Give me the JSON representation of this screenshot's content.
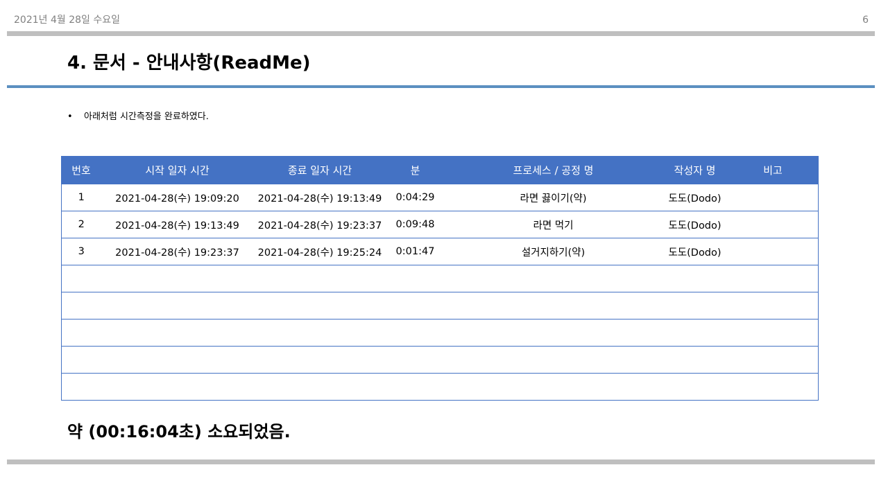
{
  "header": {
    "date": "2021년 4월 28일 수요일",
    "page_number": "6"
  },
  "title": "4. 문서 - 안내사항(ReadMe)",
  "bullet": {
    "text": "아래처럼 시간측정을 완료하였다."
  },
  "table": {
    "headers": [
      "번호",
      "시작 일자 시간",
      "종료 일자 시간",
      "분",
      "프로세스 / 공정 명",
      "작성자 명",
      "비고"
    ],
    "rows": [
      [
        "1",
        "2021-04-28(수) 19:09:20",
        "2021-04-28(수) 19:13:49",
        "0:04:29",
        "라면 끓이기(약)",
        "도도(Dodo)",
        ""
      ],
      [
        "2",
        "2021-04-28(수) 19:13:49",
        "2021-04-28(수) 19:23:37",
        "0:09:48",
        "라면 먹기",
        "도도(Dodo)",
        ""
      ],
      [
        "3",
        "2021-04-28(수) 19:23:37",
        "2021-04-28(수) 19:25:24",
        "0:01:47",
        "설거지하기(약)",
        "도도(Dodo)",
        ""
      ],
      [
        "",
        "",
        "",
        "",
        "",
        "",
        ""
      ],
      [
        "",
        "",
        "",
        "",
        "",
        "",
        ""
      ],
      [
        "",
        "",
        "",
        "",
        "",
        "",
        ""
      ],
      [
        "",
        "",
        "",
        "",
        "",
        "",
        ""
      ],
      [
        "",
        "",
        "",
        "",
        "",
        "",
        ""
      ]
    ]
  },
  "summary": "약 (00:16:04초) 소요되었음.",
  "colors": {
    "header_bg": "#4472c4",
    "accent_rule": "#5b8fc0",
    "gray_bar": "#bfbfbf"
  }
}
